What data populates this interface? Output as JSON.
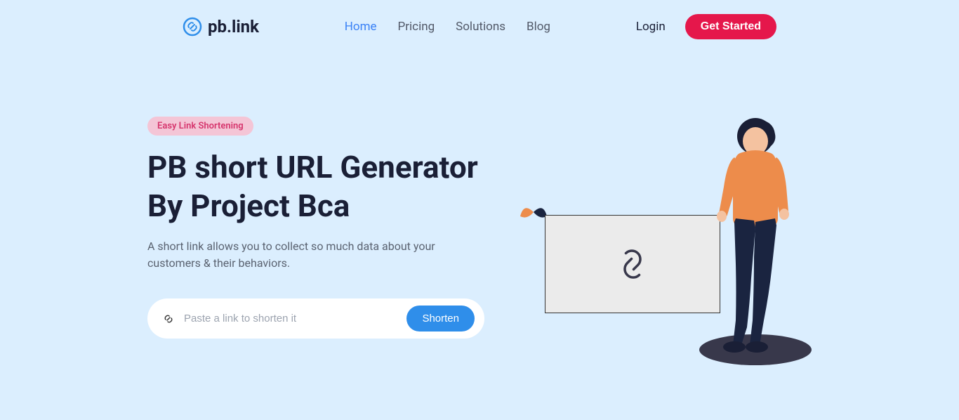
{
  "logo": {
    "text": "pb.link"
  },
  "nav": {
    "home": "Home",
    "pricing": "Pricing",
    "solutions": "Solutions",
    "blog": "Blog"
  },
  "actions": {
    "login": "Login",
    "get_started": "Get Started"
  },
  "hero": {
    "badge": "Easy Link Shortening",
    "title": "PB short URL Generator By Project Bca",
    "description": "A short link allows you to collect so much data about your customers & their behaviors.",
    "input_placeholder": "Paste a link to shorten it",
    "shorten_button": "Shorten"
  }
}
